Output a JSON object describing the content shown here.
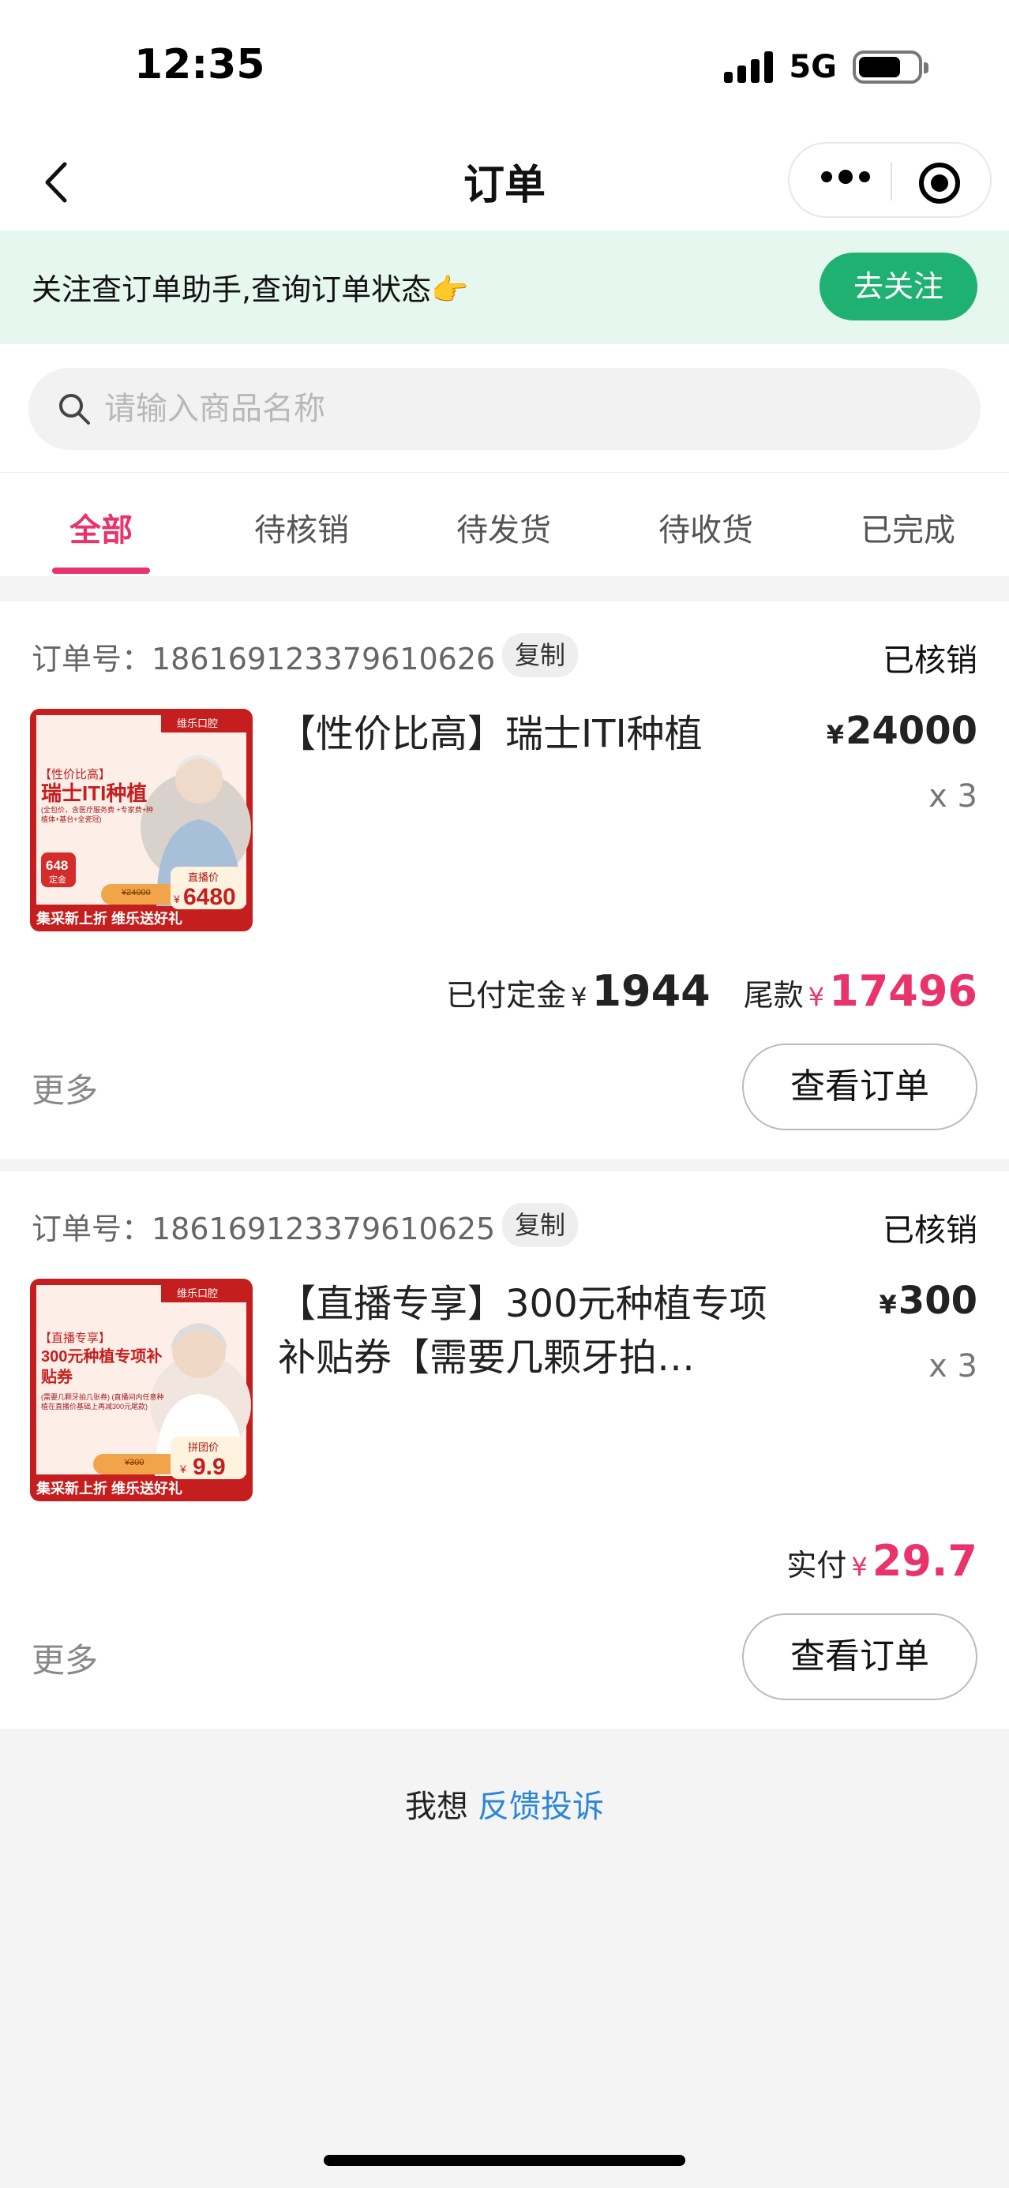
{
  "status_bar": {
    "time": "12:35",
    "network": "5G"
  },
  "nav": {
    "title": "订单"
  },
  "follow_banner": {
    "text": "关注查订单助手,查询订单状态👉",
    "button": "去关注"
  },
  "search": {
    "placeholder": "请输入商品名称"
  },
  "tabs": [
    {
      "label": "全部",
      "active": true
    },
    {
      "label": "待核销",
      "active": false
    },
    {
      "label": "待发货",
      "active": false
    },
    {
      "label": "待收货",
      "active": false
    },
    {
      "label": "已完成",
      "active": false
    }
  ],
  "orders": [
    {
      "order_no": "订单号：186169123379610626",
      "copy_label": "复制",
      "status": "已核销",
      "product_name": "【性价比高】瑞士ITI种植",
      "currency": "¥",
      "price": "24000",
      "qty": "x 3",
      "thumb": {
        "brand": "维乐口腔",
        "tag": "【性价比高】",
        "title": "瑞士ITI种植",
        "desc": "(全包价，含医疗服务费 +专家费+种植体+基台+全瓷冠)",
        "badge_price": "648",
        "badge_label": "定金",
        "old_price": "¥24000",
        "deal_label": "直播价",
        "deal_price": "6480",
        "footer": "集采新上折 维乐送好礼"
      },
      "payment": {
        "deposit_label": "已付定金",
        "deposit": "1944",
        "balance_label": "尾款",
        "balance": "17496"
      },
      "more": "更多",
      "view_button": "查看订单"
    },
    {
      "order_no": "订单号：186169123379610625",
      "copy_label": "复制",
      "status": "已核销",
      "product_name": "【直播专享】300元种植专项补贴券【需要几颗牙拍…",
      "currency": "¥",
      "price": "300",
      "qty": "x 3",
      "thumb": {
        "brand": "维乐口腔",
        "tag": "【直播专享】",
        "title": "300元种植专项补贴券",
        "desc": "(需要几颗牙拍几张券) (直播间内任意种植在直播价基础上再减300元尾款)",
        "old_price": "¥300",
        "deal_label": "拼团价",
        "deal_price": "9.9",
        "footer": "集采新上折 维乐送好礼"
      },
      "payment": {
        "paid_label": "实付",
        "paid": "29.7"
      },
      "more": "更多",
      "view_button": "查看订单"
    }
  ],
  "feedback": {
    "prefix": "我想",
    "link": "反馈投诉"
  },
  "colors": {
    "accent": "#e8336b",
    "green": "#1fb171",
    "link": "#2a86db"
  }
}
